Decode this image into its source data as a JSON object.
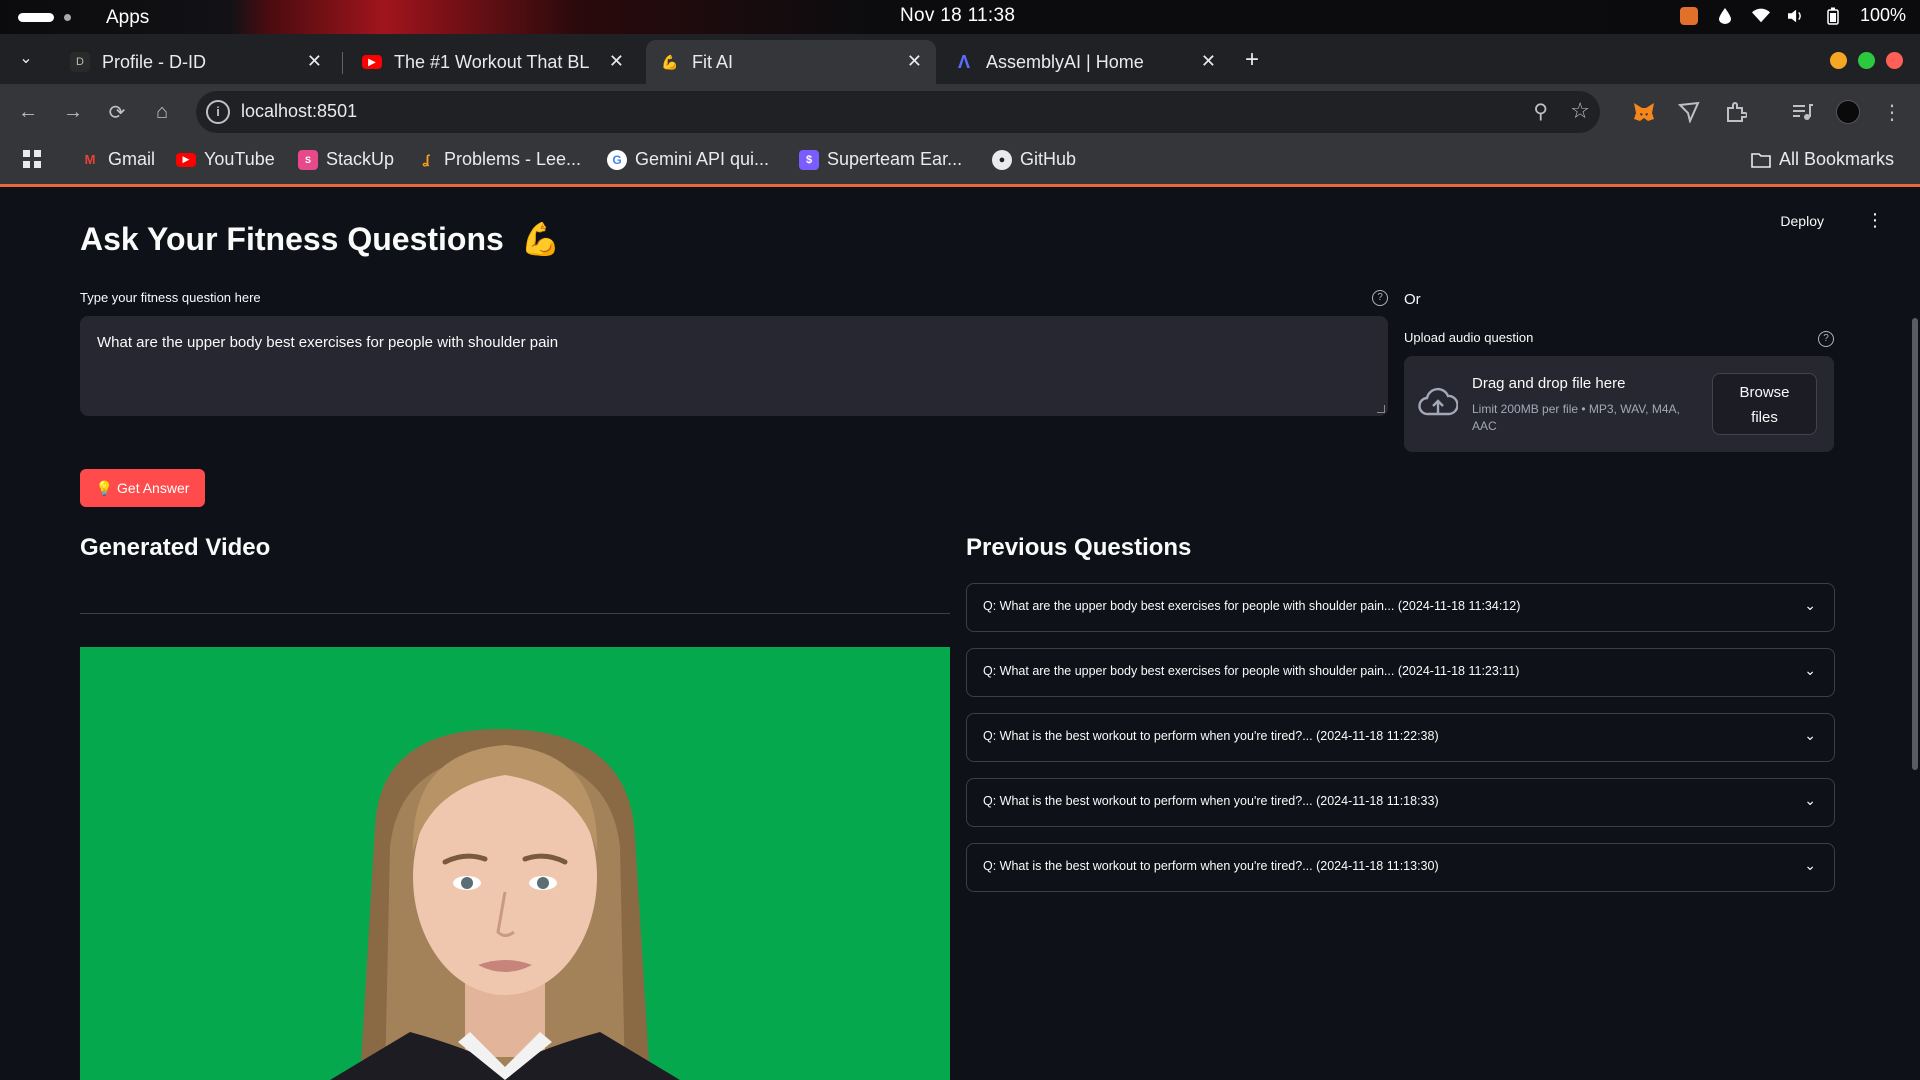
{
  "os": {
    "apps_label": "Apps",
    "clock": "Nov 18  11:38",
    "battery": "100%"
  },
  "browser": {
    "tabs": [
      {
        "title": "Profile - D-ID",
        "icon": "did-icon"
      },
      {
        "title": "The #1 Workout That BL",
        "icon": "youtube-icon"
      },
      {
        "title": "Fit AI",
        "icon": "flexed-biceps-icon"
      },
      {
        "title": "AssemblyAI | Home",
        "icon": "assemblyai-icon"
      }
    ],
    "active_tab": 2,
    "url": "localhost:8501",
    "bookmarks": [
      {
        "label": "Gmail",
        "icon": "gmail-icon"
      },
      {
        "label": "YouTube",
        "icon": "youtube-icon"
      },
      {
        "label": "StackUp",
        "icon": "stackup-icon"
      },
      {
        "label": "Problems - Lee...",
        "icon": "leetcode-icon"
      },
      {
        "label": "Gemini API qui...",
        "icon": "google-icon"
      },
      {
        "label": "Superteam Ear...",
        "icon": "superteam-icon"
      },
      {
        "label": "GitHub",
        "icon": "github-icon"
      }
    ],
    "all_bookmarks": "All Bookmarks"
  },
  "app": {
    "deploy_label": "Deploy",
    "title": "Ask Your Fitness Questions",
    "title_emoji": "💪",
    "question_label": "Type your fitness question here",
    "question_value": "What are the upper body best exercises for people with shoulder pain",
    "or_label": "Or",
    "upload_label": "Upload audio question",
    "upload_dd": "Drag and drop file here",
    "upload_limit": "Limit 200MB per file • MP3, WAV, M4A, AAC",
    "browse_line1": "Browse",
    "browse_line2": "files",
    "get_answer_emoji": "💡",
    "get_answer_label": "Get Answer",
    "video_heading": "Generated Video",
    "previous_heading": "Previous Questions",
    "previous_questions": [
      "Q: What are the upper body best exercises for people with shoulder pain... (2024-11-18 11:34:12)",
      "Q: What are the upper body best exercises for people with shoulder pain... (2024-11-18 11:23:11)",
      "Q: What is the best workout to perform when you're tired?... (2024-11-18 11:22:38)",
      "Q: What is the best workout to perform when you're tired?... (2024-11-18 11:18:33)",
      "Q: What is the best workout to perform when you're tired?... (2024-11-18 11:13:30)"
    ],
    "accent_color": "#ff4b4b",
    "video_bg_color": "#05a84d"
  }
}
